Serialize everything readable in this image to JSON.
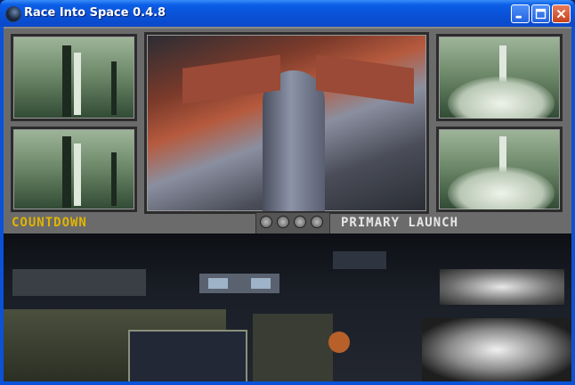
{
  "window": {
    "title": "Race Into Space 0.4.8",
    "buttons": {
      "minimize": "minimize",
      "maximize": "maximize",
      "close": "close"
    }
  },
  "labels": {
    "countdown": "COUNTDOWN",
    "primary_launch": "PRIMARY LAUNCH"
  },
  "icons": {
    "app": "app-icon",
    "minimize": "minimize-icon",
    "maximize": "maximize-icon",
    "close": "close-icon"
  },
  "colors": {
    "countdown_text": "#e2b400",
    "primary_text": "#e6e6e6",
    "titlebar": "#0a52d8"
  }
}
